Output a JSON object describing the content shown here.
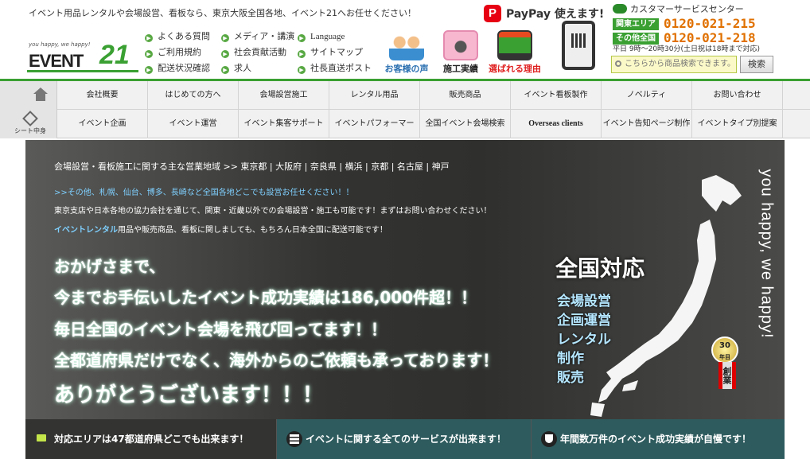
{
  "header": {
    "tagline": "イベント用品レンタルや会場設営、看板なら、東京大阪全国各地、イベント21へお任せください！",
    "logo": {
      "slogan": "you happy, we happy!",
      "word": "EVENT",
      "num": "21"
    },
    "quick_links": {
      "col1": [
        "よくある質問",
        "ご利用規約",
        "配送状況確認"
      ],
      "col2": [
        "メディア・講演",
        "社会貢献活動",
        "求人"
      ],
      "col3": [
        "Language",
        "サイトマップ",
        "社長直送ポスト"
      ]
    },
    "promos": [
      {
        "label": "お客様の声",
        "color": "#2a6fb0"
      },
      {
        "label": "施工実績",
        "color": "#222222"
      },
      {
        "label": "選ばれる理由",
        "color": "#e02020"
      }
    ],
    "paypay": {
      "icon_letter": "P",
      "text": "PayPay 使えます!"
    },
    "customer_service": {
      "title": "カスタマーサービスセンター",
      "rows": [
        {
          "tag": "関東エリア",
          "tel": "0120-021-215"
        },
        {
          "tag": "その他全国",
          "tel": "0120-021-218"
        }
      ],
      "hours": "平日 9時〜20時30分(土日祝は18時まで対応)"
    },
    "search": {
      "placeholder": "こちらから商品検索できます。",
      "button": "検索"
    }
  },
  "nav": {
    "sheet_label": "シート中身",
    "row1": [
      "会社概要",
      "はじめての方へ",
      "会場設営施工",
      "レンタル用品",
      "販売商品",
      "イベント看板製作",
      "ノベルティ",
      "お問い合わせ"
    ],
    "row2": [
      "イベント企画",
      "イベント運営",
      "イベント集客サポート",
      "イベントパフォーマー",
      "全国イベント会場検索",
      "Overseas clients",
      "イベント告知ページ制作",
      "イベントタイプ別提案"
    ]
  },
  "hero": {
    "area_line": "会場設営・看板施工に関する主な営業地域 >> 東京都 | 大阪府 | 奈良県 | 横浜 | 京都 | 名古屋 | 神戸",
    "info1": ">>その他、札幌、仙台、博多、長崎など全国各地どこでも設営お任せください！！",
    "info2": "東京支店や日本各地の協力会社を通じて、関東・近畿以外での会場設営・施工も可能です！まずはお問い合わせください！",
    "info3_em": "イベントレンタル",
    "info3_rest": "用品や販売商品、看板に関しましても、もちろん日本全国に配送可能です！",
    "big1": "おかげさまで、",
    "big2": "今までお手伝いしたイベント成功実績は186,000件超！！",
    "big3": "毎日全国のイベント会場を飛び回ってます！！",
    "big4": "全都道府県だけでなく、海外からのご依頼も承っております！",
    "big5": "ありがとうございます！！！",
    "national": "全国対応",
    "services": [
      "会場設営",
      "企画運営",
      "レンタル",
      "制作",
      "販売"
    ],
    "vertical_slogan": "you happy, we happy!",
    "badge": {
      "years": "30",
      "unit": "年目",
      "label": "創業"
    },
    "bottom": [
      "対応エリアは47都道府県どこでも出来ます！",
      "イベントに関する全てのサービスが出来ます！",
      "年間数万件のイベント成功実績が自慢です！"
    ]
  },
  "colors": {
    "brand_green": "#3aa032",
    "tel_orange": "#e07000",
    "link_blue": "#7fd0ff",
    "bottom_teal": "#2e5b5e"
  }
}
